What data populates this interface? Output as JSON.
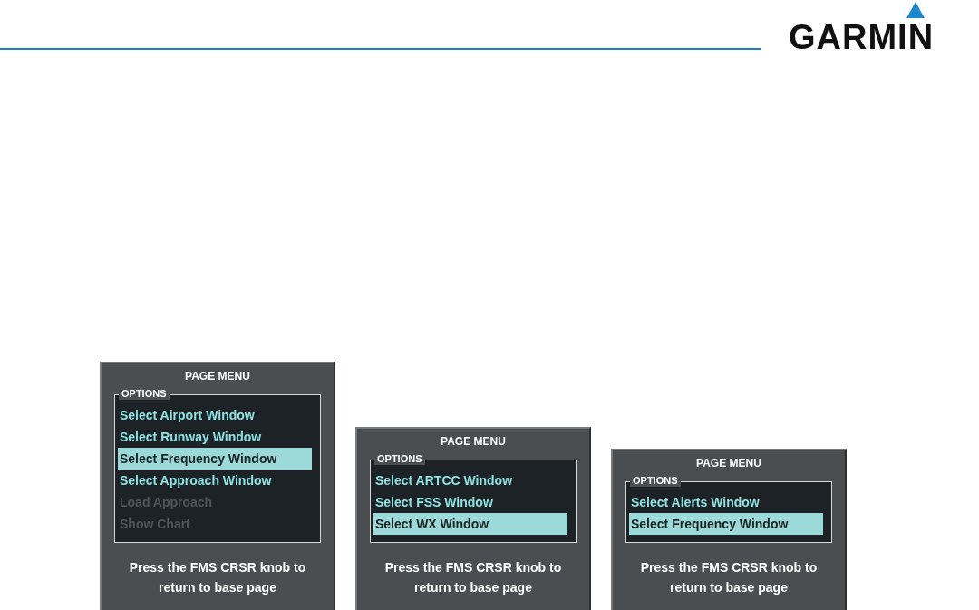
{
  "header": {
    "logo": "GARMIN"
  },
  "panels": [
    {
      "title": "PAGE MENU",
      "legend": "OPTIONS",
      "items": [
        {
          "label": "Select Airport Window",
          "selected": false,
          "disabled": false
        },
        {
          "label": "Select Runway Window",
          "selected": false,
          "disabled": false
        },
        {
          "label": "Select Frequency Window",
          "selected": true,
          "disabled": false
        },
        {
          "label": "Select Approach Window",
          "selected": false,
          "disabled": false
        },
        {
          "label": "Load Approach",
          "selected": false,
          "disabled": true
        },
        {
          "label": "Show Chart",
          "selected": false,
          "disabled": true
        }
      ],
      "footer": "Press the FMS CRSR knob to return to base page"
    },
    {
      "title": "PAGE MENU",
      "legend": "OPTIONS",
      "items": [
        {
          "label": "Select ARTCC Window",
          "selected": false,
          "disabled": false
        },
        {
          "label": "Select FSS Window",
          "selected": false,
          "disabled": false
        },
        {
          "label": "Select WX Window",
          "selected": true,
          "disabled": false
        }
      ],
      "footer": "Press the FMS CRSR knob to return to base page"
    },
    {
      "title": "PAGE MENU",
      "legend": "OPTIONS",
      "items": [
        {
          "label": "Select Alerts Window",
          "selected": false,
          "disabled": false
        },
        {
          "label": "Select Frequency Window",
          "selected": true,
          "disabled": false
        }
      ],
      "footer": "Press the FMS CRSR knob to return to base page"
    }
  ]
}
